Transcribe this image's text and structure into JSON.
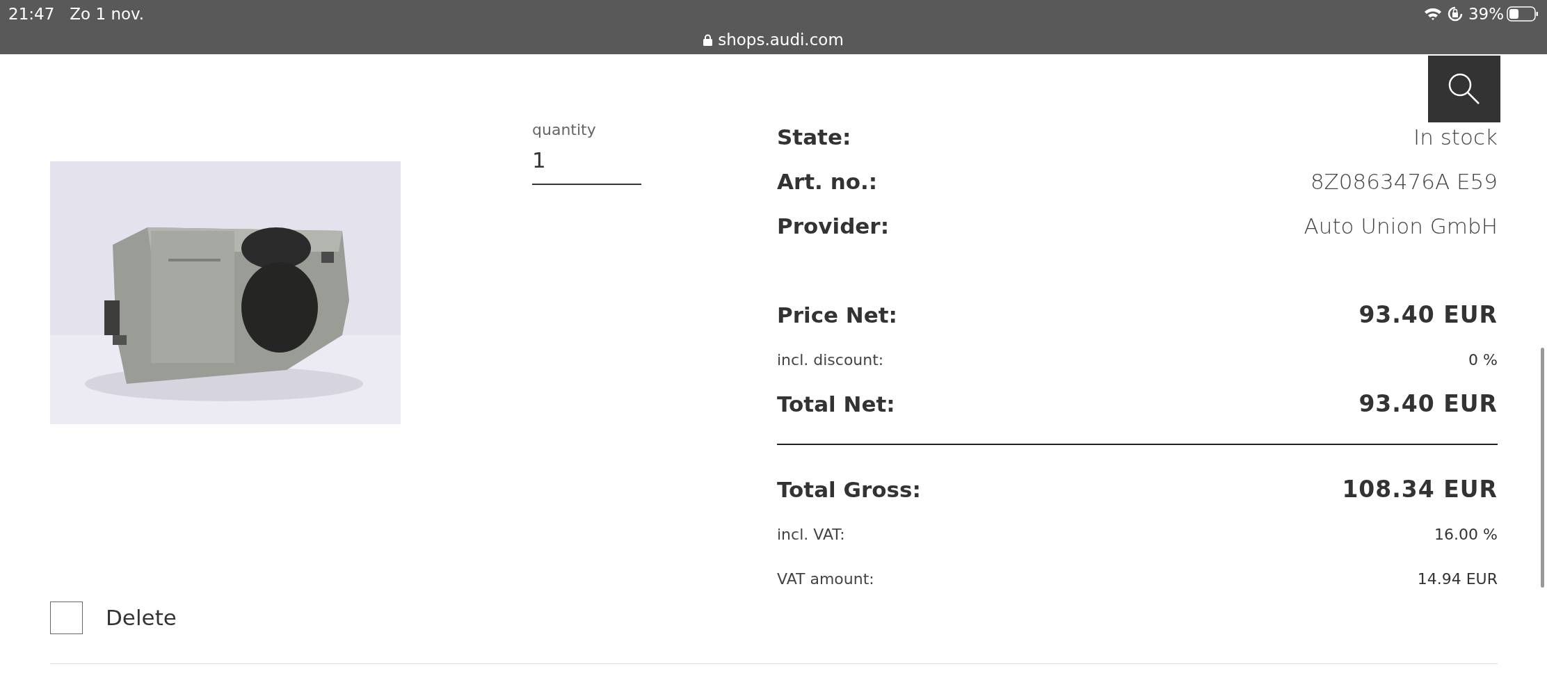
{
  "status_bar": {
    "time": "21:47",
    "date": "Zo 1 nov.",
    "url": "shops.audi.com",
    "battery": "39%"
  },
  "product": {
    "quantity": {
      "label": "quantity",
      "value": "1"
    },
    "delete": {
      "label": "Delete",
      "checked": false
    }
  },
  "details": [
    {
      "label": "State:",
      "value": "In stock"
    },
    {
      "label": "Art. no.:",
      "value": "8Z0863476A E59"
    },
    {
      "label": "Provider:",
      "value": "Auto Union GmbH"
    }
  ],
  "prices": [
    {
      "kind": "main",
      "label": "Price Net:",
      "value": "93.40 EUR"
    },
    {
      "kind": "sub",
      "label": "incl. discount:",
      "value": "0 %"
    },
    {
      "kind": "main",
      "label": "Total Net:",
      "value": "93.40 EUR"
    },
    {
      "kind": "rule"
    },
    {
      "kind": "main",
      "label": "Total Gross:",
      "value": "108.34 EUR"
    },
    {
      "kind": "sub",
      "label": "incl. VAT:",
      "value": "16.00 %"
    },
    {
      "kind": "sub",
      "label": "VAT amount:",
      "value": "14.94 EUR"
    }
  ]
}
